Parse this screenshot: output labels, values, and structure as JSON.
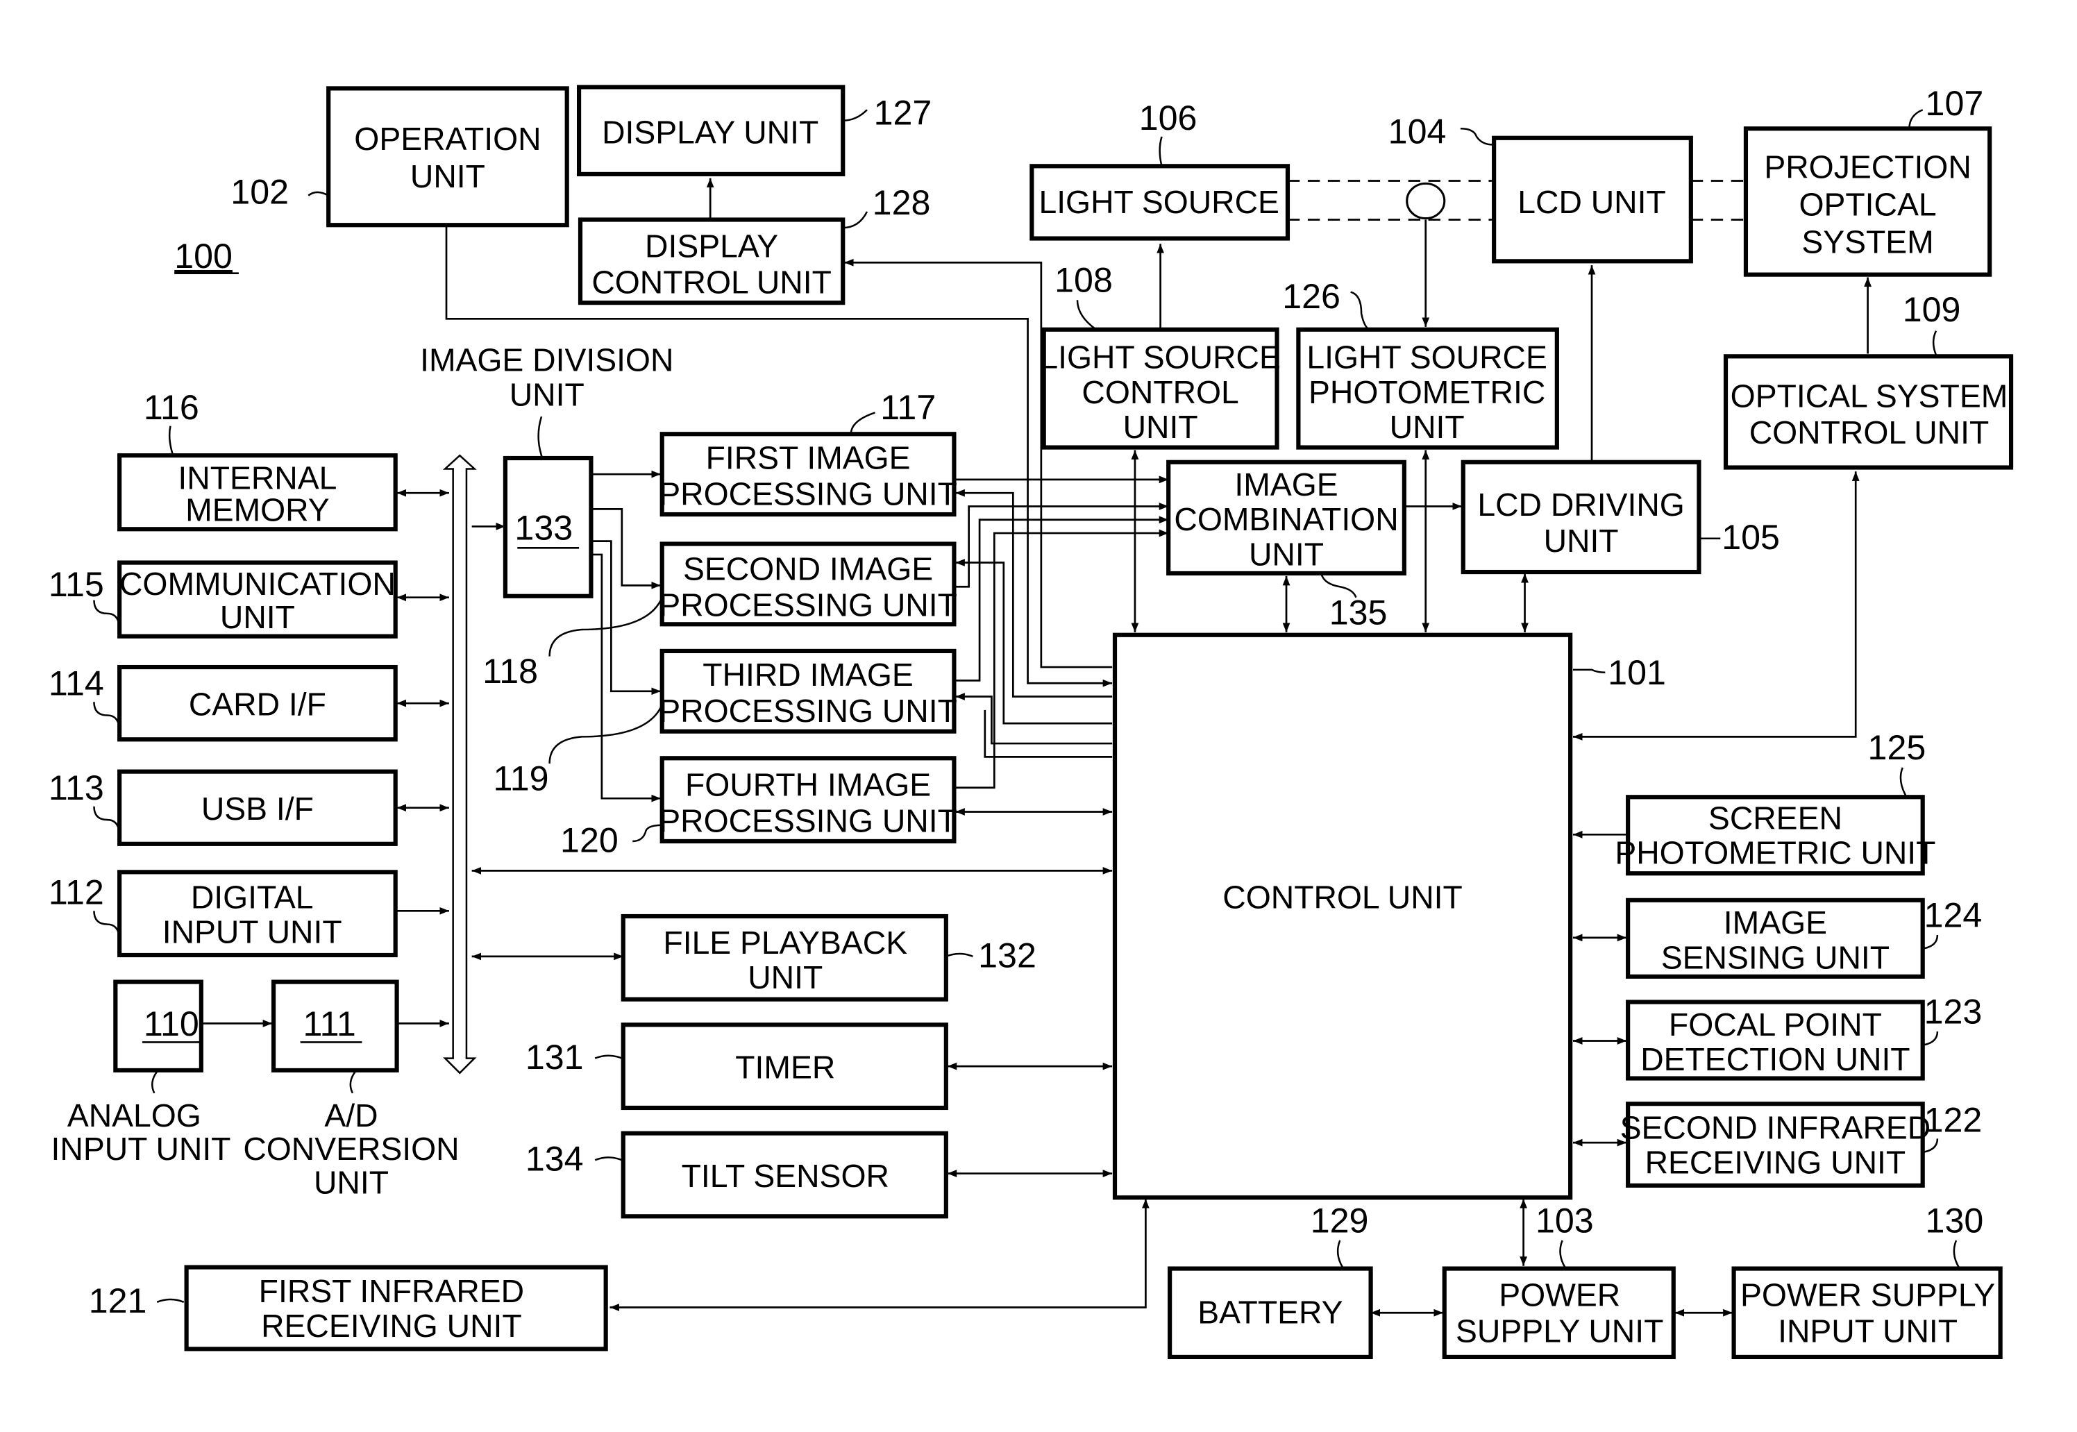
{
  "figure_ref": "100",
  "blocks": {
    "operation_unit": {
      "ref": "102",
      "lines": [
        "OPERATION",
        "UNIT"
      ]
    },
    "display_unit": {
      "ref": "127",
      "lines": [
        "DISPLAY UNIT"
      ]
    },
    "display_control_unit": {
      "ref": "128",
      "lines": [
        "DISPLAY",
        "CONTROL UNIT"
      ]
    },
    "light_source": {
      "ref": "106",
      "lines": [
        "LIGHT SOURCE"
      ]
    },
    "lcd_unit": {
      "ref": "104",
      "lines": [
        "LCD UNIT"
      ]
    },
    "projection_optical_system": {
      "ref": "107",
      "lines": [
        "PROJECTION",
        "OPTICAL",
        "SYSTEM"
      ]
    },
    "light_source_control_unit": {
      "ref": "108",
      "lines": [
        "LIGHT SOURCE",
        "CONTROL",
        "UNIT"
      ]
    },
    "light_source_photometric_unit": {
      "ref": "126",
      "lines": [
        "LIGHT SOURCE",
        "PHOTOMETRIC",
        "UNIT"
      ]
    },
    "optical_system_control_unit": {
      "ref": "109",
      "lines": [
        "OPTICAL SYSTEM",
        "CONTROL UNIT"
      ]
    },
    "image_division_unit": {
      "ref": "133",
      "label_lines": [
        "IMAGE DIVISION",
        "UNIT"
      ]
    },
    "first_image_processing_unit": {
      "ref": "117",
      "lines": [
        "FIRST IMAGE",
        "PROCESSING UNIT"
      ]
    },
    "second_image_processing_unit": {
      "ref": "118",
      "lines": [
        "SECOND IMAGE",
        "PROCESSING UNIT"
      ]
    },
    "third_image_processing_unit": {
      "ref": "119",
      "lines": [
        "THIRD IMAGE",
        "PROCESSING UNIT"
      ]
    },
    "fourth_image_processing_unit": {
      "ref": "120",
      "lines": [
        "FOURTH IMAGE",
        "PROCESSING UNIT"
      ]
    },
    "image_combination_unit": {
      "ref": "135",
      "lines": [
        "IMAGE",
        "COMBINATION",
        "UNIT"
      ]
    },
    "lcd_driving_unit": {
      "ref": "105",
      "lines": [
        "LCD DRIVING",
        "UNIT"
      ]
    },
    "control_unit": {
      "ref": "101",
      "lines": [
        "CONTROL UNIT"
      ]
    },
    "internal_memory": {
      "ref": "116",
      "lines": [
        "INTERNAL",
        "MEMORY"
      ]
    },
    "communication_unit": {
      "ref": "115",
      "lines": [
        "COMMUNICATION",
        "UNIT"
      ]
    },
    "card_if": {
      "ref": "114",
      "lines": [
        "CARD I/F"
      ]
    },
    "usb_if": {
      "ref": "113",
      "lines": [
        "USB I/F"
      ]
    },
    "digital_input_unit": {
      "ref": "112",
      "lines": [
        "DIGITAL",
        "INPUT UNIT"
      ]
    },
    "analog_input_unit": {
      "ref": "110",
      "label_lines": [
        "ANALOG",
        "INPUT UNIT"
      ]
    },
    "ad_conversion_unit": {
      "ref": "111",
      "label_lines": [
        "A/D",
        "CONVERSION",
        "UNIT"
      ]
    },
    "file_playback_unit": {
      "ref": "132",
      "lines": [
        "FILE PLAYBACK",
        "UNIT"
      ]
    },
    "timer": {
      "ref": "131",
      "lines": [
        "TIMER"
      ]
    },
    "tilt_sensor": {
      "ref": "134",
      "lines": [
        "TILT SENSOR"
      ]
    },
    "first_infrared_receiving_unit": {
      "ref": "121",
      "lines": [
        "FIRST INFRARED",
        "RECEIVING UNIT"
      ]
    },
    "screen_photometric_unit": {
      "ref": "125",
      "lines": [
        "SCREEN",
        "PHOTOMETRIC UNIT"
      ]
    },
    "image_sensing_unit": {
      "ref": "124",
      "lines": [
        "IMAGE",
        "SENSING UNIT"
      ]
    },
    "focal_point_detection_unit": {
      "ref": "123",
      "lines": [
        "FOCAL POINT",
        "DETECTION UNIT"
      ]
    },
    "second_infrared_receiving_unit": {
      "ref": "122",
      "lines": [
        "SECOND INFRARED",
        "RECEIVING UNIT"
      ]
    },
    "battery": {
      "ref": "129",
      "lines": [
        "BATTERY"
      ]
    },
    "power_supply_unit": {
      "ref": "103",
      "lines": [
        "POWER",
        "SUPPLY UNIT"
      ]
    },
    "power_supply_input_unit": {
      "ref": "130",
      "lines": [
        "POWER SUPPLY",
        "INPUT UNIT"
      ]
    }
  }
}
